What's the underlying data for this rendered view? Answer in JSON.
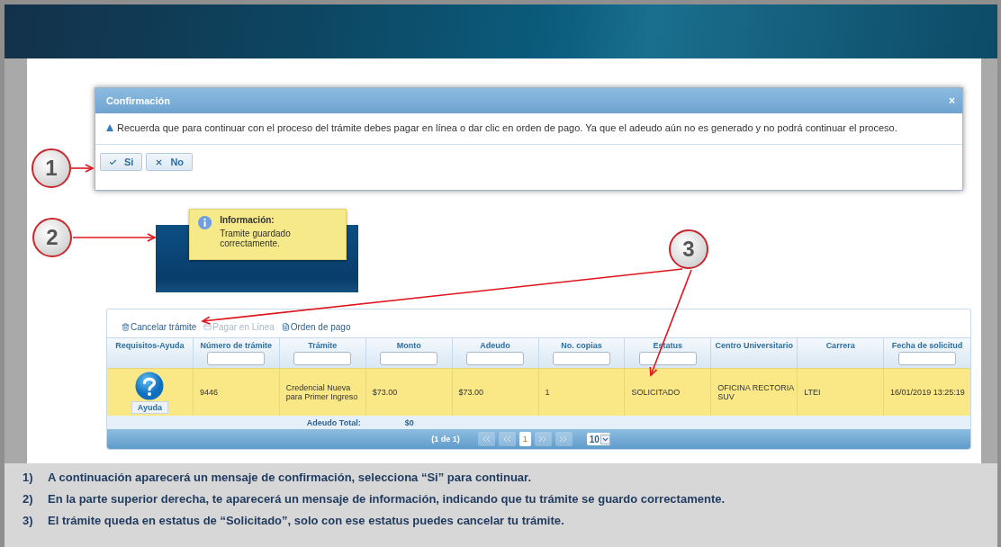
{
  "dialog": {
    "title": "Confirmación",
    "close": "×",
    "message": "Recuerda que para continuar con el proceso del trámite debes pagar en línea o dar clic en orden de pago. Ya que el adeudo aún no es generado y no podrá continuar el proceso.",
    "buttons": [
      {
        "label": "Si",
        "kind": "confirm"
      },
      {
        "label": "No",
        "kind": "cancel"
      }
    ]
  },
  "notification": {
    "title": "Información:",
    "message": "Tramite guardado correctamente."
  },
  "toolbar": [
    {
      "label": "Cancelar trámite",
      "kind": "cancel",
      "disabled": false
    },
    {
      "label": "Pagar en Línea",
      "kind": "pay",
      "disabled": true
    },
    {
      "label": "Orden de pago",
      "kind": "order",
      "disabled": false
    }
  ],
  "table": {
    "columns": [
      {
        "label": "Requisitos-Ayuda",
        "filter": false
      },
      {
        "label": "Número de trámite",
        "filter": true
      },
      {
        "label": "Trámite",
        "filter": true
      },
      {
        "label": "Monto",
        "filter": true
      },
      {
        "label": "Adeudo",
        "filter": true
      },
      {
        "label": "No. copias",
        "filter": true
      },
      {
        "label": "Estatus",
        "filter": true
      },
      {
        "label": "Centro Universitario",
        "filter": false
      },
      {
        "label": "Carrera",
        "filter": false
      },
      {
        "label": "Fecha de solicitud",
        "filter": true
      }
    ],
    "rows": [
      {
        "selected": true,
        "cells": [
          "Ayuda",
          "9446",
          "Credencial Nueva para Primer Ingreso",
          "$73.00",
          "$73.00",
          "1",
          "SOLICITADO",
          "OFICINA RECTORIA SUV",
          "LTEI",
          "16/01/2019 13:25:19"
        ]
      }
    ],
    "footer": {
      "label": "Adeudo Total:",
      "value": "$0"
    },
    "pager": {
      "summary": "(1 de 1)",
      "pages": [
        {
          "label": "1",
          "selected": true
        }
      ],
      "page_size": "10"
    }
  },
  "annotations": [
    {
      "number": "1"
    },
    {
      "number": "2"
    },
    {
      "number": "3"
    }
  ],
  "instructions": [
    {
      "number": "1)",
      "text": "A continuación aparecerá un mensaje de confirmación, selecciona “Si” para continuar."
    },
    {
      "number": "2)",
      "text": "En la parte superior derecha, te aparecerá un mensaje de información, indicando que tu trámite se guardo correctamente."
    },
    {
      "number": "3)",
      "text": "El trámite queda en estatus de “Solicitado”, solo con ese estatus puedes cancelar tu trámite."
    }
  ]
}
